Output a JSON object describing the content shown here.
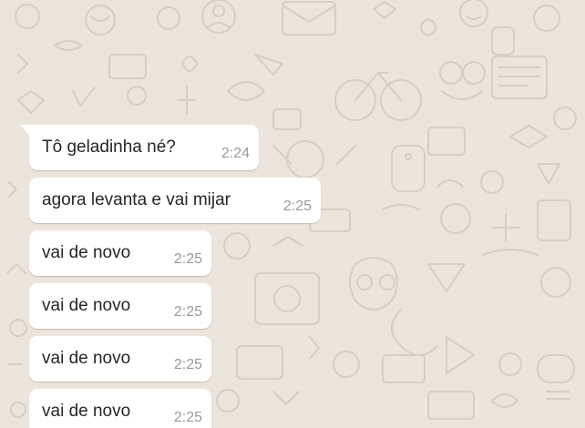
{
  "chat": {
    "messages": [
      {
        "text": "Tô geladinha né?",
        "time": "2:24"
      },
      {
        "text": "agora levanta e vai mijar",
        "time": "2:25"
      },
      {
        "text": "vai de novo",
        "time": "2:25"
      },
      {
        "text": "vai de novo",
        "time": "2:25"
      },
      {
        "text": "vai de novo",
        "time": "2:25"
      },
      {
        "text": "vai de novo",
        "time": "2:25"
      }
    ]
  },
  "colors": {
    "background": "#ece5dc",
    "bubble": "#ffffff",
    "text": "#262626",
    "timestamp": "#9a9a9a"
  }
}
